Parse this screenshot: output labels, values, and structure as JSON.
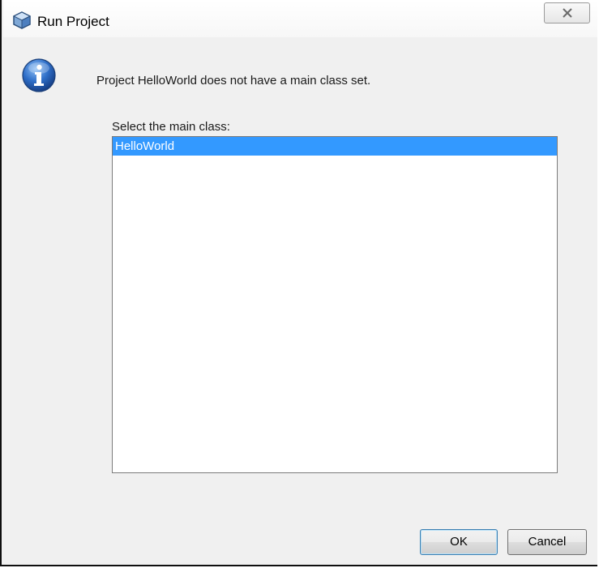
{
  "window": {
    "title": "Run Project",
    "close_glyph": "close-x-icon"
  },
  "colors": {
    "selection": "#3399ff",
    "dialog_background": "#f0f0f0",
    "info_icon": "#1f5fb5"
  },
  "dialog": {
    "message": "Project HelloWorld does not have a main class set.",
    "select_label": "Select the main class:",
    "classes": [
      {
        "name": "HelloWorld",
        "selected": true
      }
    ],
    "ok_label": "OK",
    "cancel_label": "Cancel"
  }
}
